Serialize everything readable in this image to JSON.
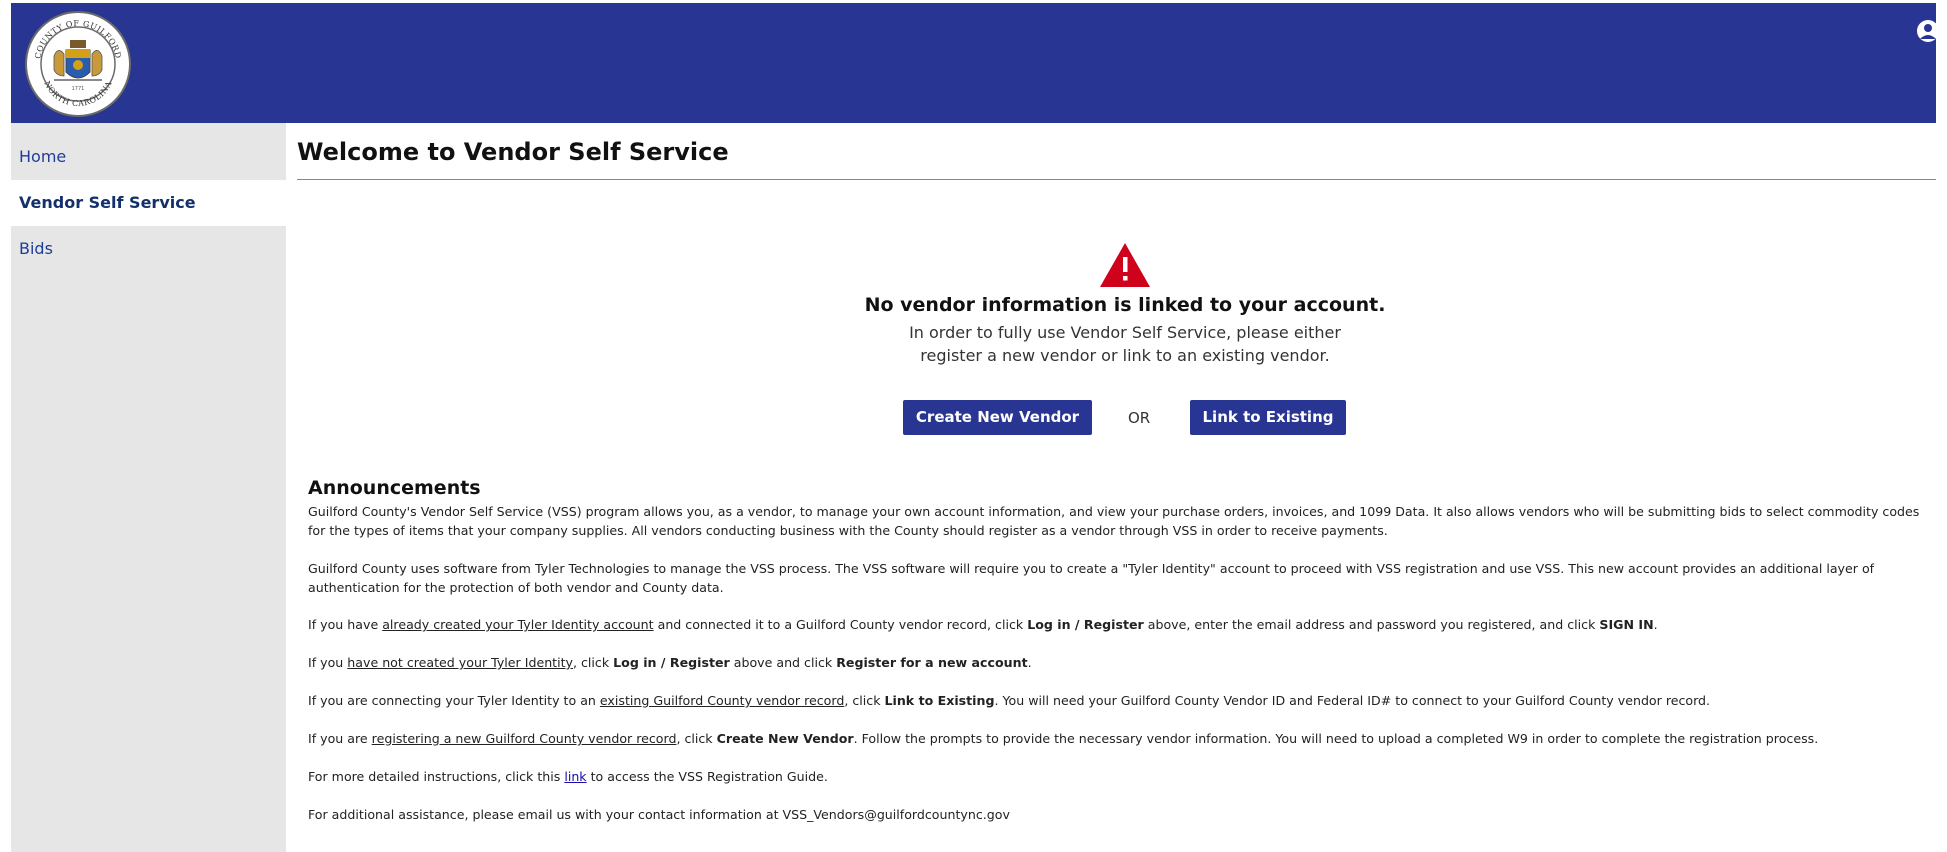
{
  "header": {
    "logo": {
      "top_text": "COUNTY OF GUILFORD",
      "bottom_text": "NORTH CAROLINA",
      "year": "1771"
    },
    "user_icon": "user-icon",
    "color": "#283593"
  },
  "sidebar": {
    "items": [
      {
        "label": "Home",
        "active": false
      },
      {
        "label": "Vendor Self Service",
        "active": true
      },
      {
        "label": "Bids",
        "active": false
      }
    ]
  },
  "main": {
    "title": "Welcome to Vendor Self Service",
    "warning": {
      "icon": "warning-icon",
      "heading": "No vendor information is linked to your account.",
      "line1": "In order to fully use Vendor Self Service, please either",
      "line2": "register a new vendor or link to an existing vendor."
    },
    "actions": {
      "create_label": "Create New Vendor",
      "or_label": "OR",
      "link_label": "Link to Existing"
    }
  },
  "announcements": {
    "title": "Announcements",
    "p1": "Guilford County's Vendor Self Service (VSS) program allows you, as a vendor, to manage your own account information, and view your purchase orders, invoices, and 1099 Data. It also allows vendors who will be submitting bids to select commodity codes for the types of items that your company supplies. All vendors conducting business with the County should register as a vendor through VSS in order to receive payments.",
    "p2": "Guilford County uses software from Tyler Technologies to manage the VSS process. The VSS software will require you to create a \"Tyler Identity\" account to proceed with VSS registration and use VSS. This new account provides an additional layer of authentication for the protection of both vendor and County data.",
    "p3": {
      "a": "If you have ",
      "u1": "already created your Tyler Identity account",
      "b": " and connected it to a Guilford County vendor record, click ",
      "bold1": "Log in / Register",
      "c": " above, enter the email address and password you registered, and click ",
      "bold2": "SIGN IN",
      "d": "."
    },
    "p4": {
      "a": "If you ",
      "u1": "have not created your Tyler Identity",
      "b": ", click ",
      "bold1": "Log in / Register",
      "c": " above and click ",
      "bold2": "Register for a new account",
      "d": "."
    },
    "p5": {
      "a": "If you are connecting your Tyler Identity to an ",
      "u1": "existing Guilford County vendor record",
      "b": ", click ",
      "bold1": "Link to Existing",
      "c": ". You will need your Guilford County Vendor ID and Federal ID# to connect to your Guilford County vendor record."
    },
    "p6": {
      "a": "If you are ",
      "u1": "registering a new Guilford County vendor record",
      "b": ", click ",
      "bold1": "Create New Vendor",
      "c": ". Follow the prompts to provide the necessary vendor information. You will need to upload a completed W9 in order to complete the registration process."
    },
    "p7": {
      "a": "For more detailed instructions, click this ",
      "link": "link",
      "b": " to access the VSS Registration Guide."
    },
    "p8": "For additional assistance, please email us with your contact information at VSS_Vendors@guilfordcountync.gov"
  }
}
